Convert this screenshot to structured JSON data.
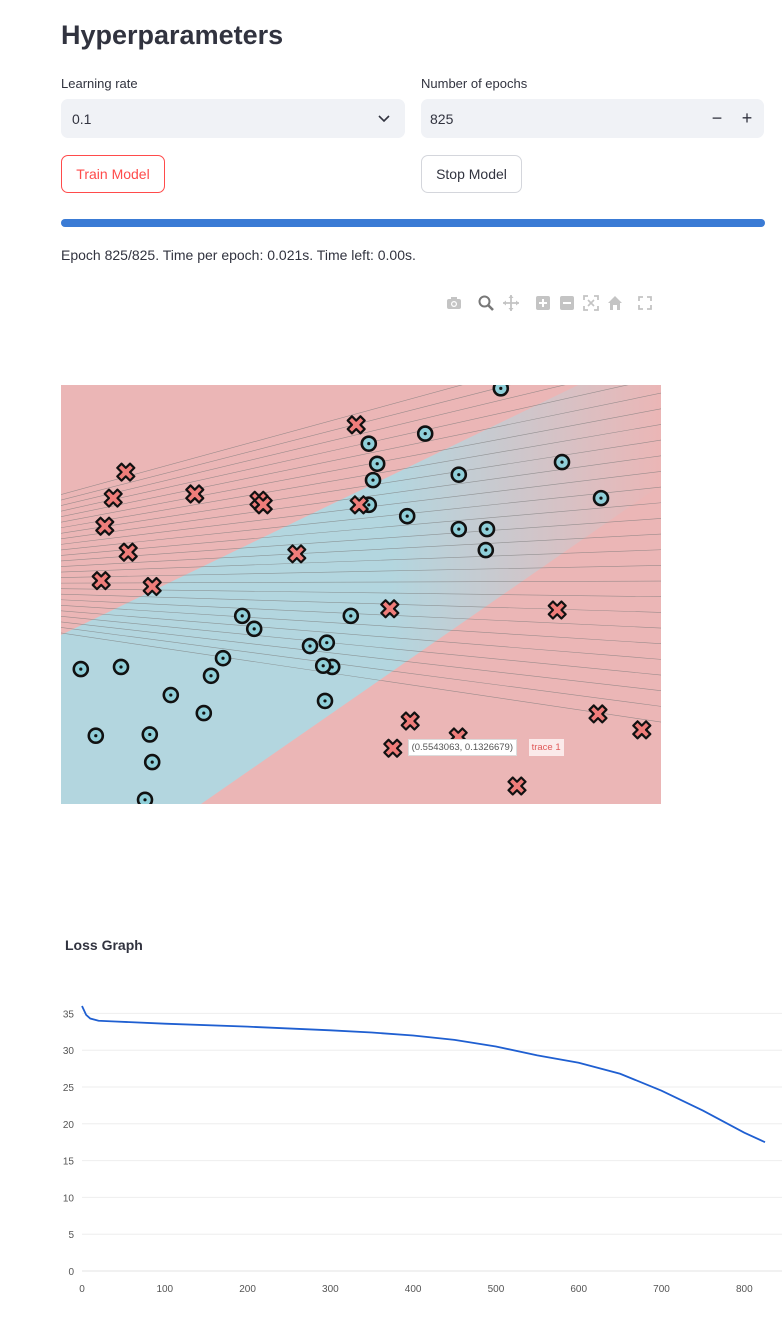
{
  "header": {
    "title": "Hyperparameters"
  },
  "learning_rate": {
    "label": "Learning rate",
    "value": "0.1"
  },
  "epochs": {
    "label": "Number of epochs",
    "value": "825",
    "minus": "−",
    "plus": "+"
  },
  "buttons": {
    "train": "Train Model",
    "stop": "Stop Model"
  },
  "progress": {
    "fraction": 1.0,
    "fill_color": "#3a7bd5"
  },
  "status_text": "Epoch 825/825. Time per epoch: 0.021s. Time left: 0.00s.",
  "modebar_icons": [
    "camera-icon",
    "zoom-icon",
    "pan-icon",
    "zoom-in-icon",
    "zoom-out-icon",
    "autoscale-icon",
    "home-icon",
    "fullscreen-icon"
  ],
  "decision_plot": {
    "tooltip": {
      "coords": "(0.5543063, 0.1326679)",
      "trace": "trace 1"
    },
    "colors": {
      "class_x": "#ef7d7a",
      "class_o": "#8fcfd9",
      "region_red": "#ebb6b6",
      "region_blue": "#b3d6df"
    }
  },
  "chart_data": [
    {
      "type": "scatter",
      "title": "",
      "xlabel": "",
      "ylabel": "",
      "xlim": [
        0,
        1
      ],
      "ylim": [
        0,
        1
      ],
      "series": [
        {
          "marker": "x",
          "x": [
            0.108,
            0.087,
            0.073,
            0.112,
            0.067,
            0.152,
            0.223,
            0.33,
            0.337,
            0.393,
            0.492,
            0.497,
            0.548,
            0.582,
            0.827,
            0.895,
            0.968,
            0.553,
            0.76,
            0.662
          ],
          "y": [
            0.792,
            0.73,
            0.663,
            0.601,
            0.533,
            0.519,
            0.74,
            0.725,
            0.714,
            0.597,
            0.905,
            0.714,
            0.466,
            0.198,
            0.463,
            0.215,
            0.177,
            0.133,
            0.043,
            0.16
          ]
        },
        {
          "marker": "o",
          "x": [
            0.733,
            0.607,
            0.513,
            0.527,
            0.52,
            0.513,
            0.577,
            0.663,
            0.71,
            0.663,
            0.835,
            0.9,
            0.708,
            0.483,
            0.452,
            0.415,
            0.302,
            0.322,
            0.27,
            0.25,
            0.238,
            0.183,
            0.148,
            0.1,
            0.033,
            0.058,
            0.152,
            0.14,
            0.443,
            0.437,
            0.44
          ],
          "y": [
            0.992,
            0.884,
            0.86,
            0.812,
            0.773,
            0.714,
            0.687,
            0.786,
            0.656,
            0.656,
            0.816,
            0.73,
            0.606,
            0.449,
            0.327,
            0.377,
            0.449,
            0.418,
            0.348,
            0.306,
            0.217,
            0.26,
            0.166,
            0.327,
            0.322,
            0.163,
            0.1,
            0.01,
            0.385,
            0.33,
            0.246
          ]
        }
      ]
    },
    {
      "type": "line",
      "title": "Loss Graph",
      "xlabel": "",
      "ylabel": "",
      "xlim": [
        0,
        825
      ],
      "ylim": [
        0,
        36
      ],
      "xticks": [
        "0",
        "100",
        "200",
        "300",
        "400",
        "500",
        "600",
        "700",
        "800"
      ],
      "yticks": [
        "0",
        "5",
        "10",
        "15",
        "20",
        "25",
        "30",
        "35"
      ],
      "series": [
        {
          "color": "#1f5fd1",
          "x": [
            0,
            5,
            10,
            20,
            40,
            100,
            200,
            300,
            350,
            400,
            450,
            500,
            550,
            600,
            650,
            700,
            750,
            800,
            825
          ],
          "y": [
            36.0,
            34.8,
            34.3,
            34.0,
            33.9,
            33.6,
            33.2,
            32.7,
            32.4,
            32.0,
            31.4,
            30.5,
            29.3,
            28.3,
            26.8,
            24.5,
            21.8,
            18.8,
            17.5
          ]
        }
      ]
    }
  ]
}
